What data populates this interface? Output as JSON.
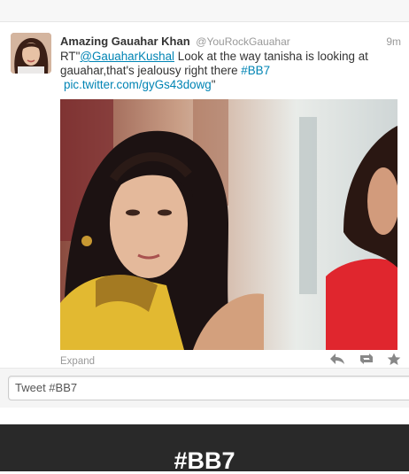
{
  "tweet": {
    "author_name": "Amazing Gauahar Khan",
    "author_handle": "@YouRockGauahar",
    "time": "9m",
    "text_prefix": "RT\"",
    "mention": "@GauaharKushal",
    "text_body": " Look at the way tanisha is looking at gauahar,that's jealousy right there ",
    "hashtag": "#BB7",
    "link": "pic.twitter.com/gyGs43dowg",
    "text_suffix": "\"",
    "expand_label": "Expand",
    "actions": {
      "reply_icon": "reply-icon",
      "retweet_icon": "retweet-icon",
      "favorite_icon": "star-icon"
    }
  },
  "compose": {
    "value": "Tweet #BB7"
  },
  "hashtag_header": {
    "title": "#BB7"
  },
  "colors": {
    "link": "#0084b4",
    "muted": "#999999",
    "dark_bar": "#292929"
  }
}
